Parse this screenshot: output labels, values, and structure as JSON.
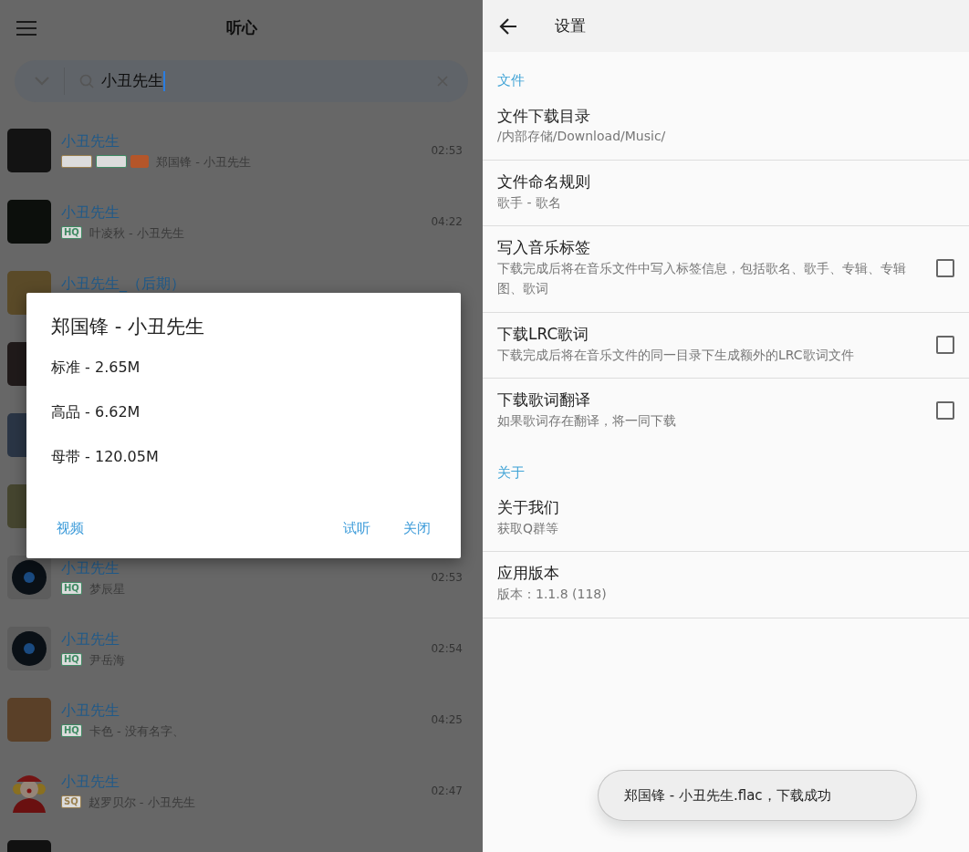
{
  "search_screen": {
    "title": "听心",
    "search": {
      "value": "小丑先生"
    },
    "results": [
      {
        "kind": "photo",
        "title": "小丑先生",
        "tags": [
          {
            "kind": "outline",
            "color": "#9a8050"
          },
          {
            "kind": "outline",
            "color": "#3f8a63"
          },
          {
            "kind": "filled",
            "color": "#b4562a"
          }
        ],
        "artist": "郑国锋 - 小丑先生",
        "duration": "02:53"
      },
      {
        "kind": "photo",
        "title": "小丑先生",
        "tags": [
          {
            "kind": "outline",
            "color": "#3f8a63",
            "text": "HQ"
          }
        ],
        "artist": "叶凌秋 - 小丑先生",
        "duration": "04:22"
      },
      {
        "kind": "photo",
        "title": "小丑先生_（后期）"
      },
      {
        "kind": "photo"
      },
      {
        "kind": "photo"
      },
      {
        "kind": "photo"
      },
      {
        "kind": "disc",
        "title": "小丑先生",
        "tags": [
          {
            "kind": "outline",
            "color": "#3f8a63",
            "text": "HQ"
          }
        ],
        "artist": "梦辰星",
        "duration": "02:53"
      },
      {
        "kind": "disc",
        "title": "小丑先生",
        "tags": [
          {
            "kind": "outline",
            "color": "#3f8a63",
            "text": "HQ"
          }
        ],
        "artist": "尹岳海",
        "duration": "02:54"
      },
      {
        "kind": "photo",
        "title": "小丑先生",
        "tags": [
          {
            "kind": "outline",
            "color": "#3f8a63",
            "text": "HQ"
          }
        ],
        "artist": "卡色 - 没有名字、",
        "duration": "04:25"
      },
      {
        "kind": "clown",
        "title": "小丑先生",
        "tags": [
          {
            "kind": "outline",
            "color": "#9a8050",
            "text": "SQ"
          }
        ],
        "artist": "赵罗贝尔 - 小丑先生",
        "duration": "02:47"
      },
      {
        "kind": "photo"
      }
    ],
    "dialog": {
      "title": "郑国锋 - 小丑先生",
      "options": [
        "标准 - 2.65M",
        "高品 - 6.62M",
        "母带 - 120.05M"
      ],
      "buttons": [
        "视频",
        "试听",
        "关闭"
      ]
    }
  },
  "settings_screen": {
    "title": "设置",
    "sections": [
      {
        "header": "文件",
        "items": [
          {
            "kind": "text",
            "title": "文件下载目录",
            "subtitle": "/内部存储/Download/Music/"
          },
          {
            "kind": "text",
            "title": "文件命名规则",
            "subtitle": "歌手 - 歌名"
          },
          {
            "kind": "checkbox",
            "title": "写入音乐标签",
            "subtitle": "下载完成后将在音乐文件中写入标签信息，包括歌名、歌手、专辑、专辑图、歌词",
            "checked": false
          },
          {
            "kind": "checkbox",
            "title": "下载LRC歌词",
            "subtitle": "下载完成后将在音乐文件的同一目录下生成额外的LRC歌词文件",
            "checked": false
          },
          {
            "kind": "checkbox",
            "title": "下载歌词翻译",
            "subtitle": "如果歌词存在翻译，将一同下载",
            "checked": false
          }
        ]
      },
      {
        "header": "关于",
        "items": [
          {
            "kind": "text",
            "title": "关于我们",
            "subtitle": "获取Q群等"
          },
          {
            "kind": "text",
            "title": "应用版本",
            "subtitle": "版本：1.1.8 (118)"
          }
        ]
      }
    ],
    "toast": "郑国锋 - 小丑先生.flac，下载成功"
  }
}
